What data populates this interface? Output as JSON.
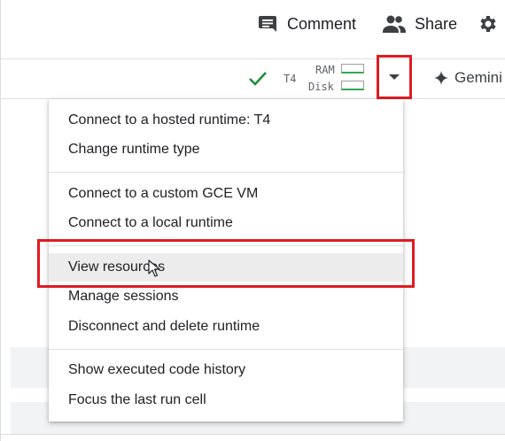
{
  "header": {
    "comment_label": "Comment",
    "share_label": "Share",
    "icons": [
      "comment-icon",
      "share-people-icon",
      "settings-gear-icon"
    ]
  },
  "toolbar": {
    "status_icon": "check-icon",
    "runtime_label": "T4",
    "ram_label": "RAM",
    "disk_label": "Disk",
    "dropdown_icon": "caret-down-icon",
    "gemini_label": "Gemini",
    "gemini_icon": "sparkle-icon"
  },
  "menu": {
    "items": [
      "Connect to a hosted runtime: T4",
      "Change runtime type",
      "Connect to a custom GCE VM",
      "Connect to a local runtime",
      "View resources",
      "Manage sessions",
      "Disconnect and delete runtime",
      "Show executed code history",
      "Focus the last run cell"
    ],
    "hovered_item": "View resources"
  },
  "colors": {
    "highlight_red": "#e01b22",
    "check_green": "#1e8e3e",
    "meter_green": "#34a853",
    "hover_bg": "#ececec"
  }
}
